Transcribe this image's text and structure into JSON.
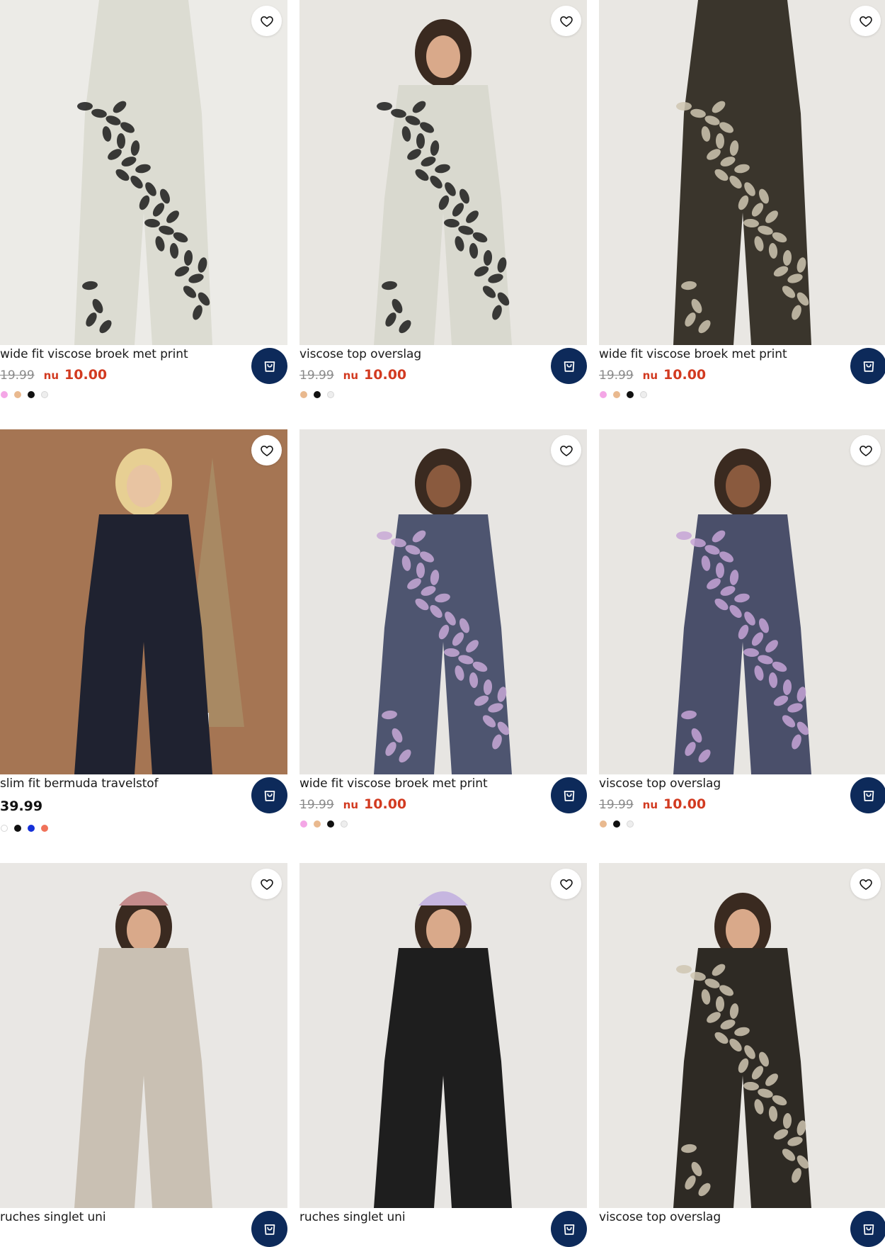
{
  "products": [
    {
      "title": "wide fit viscose broek met print",
      "old_price": "19.99",
      "nu_label": "nu",
      "price": "10.00",
      "sale": true,
      "swatches": [
        "#f4a6e6",
        "#e9b98f",
        "#111111",
        "#eeeeee"
      ],
      "bg": "#ecebe7",
      "garment": "#dcdcd2",
      "print": "#1b1b1b"
    },
    {
      "title": "viscose top overslag",
      "old_price": "19.99",
      "nu_label": "nu",
      "price": "10.00",
      "sale": true,
      "swatches": [
        "#e9b98f",
        "#111111",
        "#eeeeee"
      ],
      "bg": "#e8e6e1",
      "garment": "#d9d9cf",
      "print": "#1b1b1b"
    },
    {
      "title": "wide fit viscose broek met print",
      "old_price": "19.99",
      "nu_label": "nu",
      "price": "10.00",
      "sale": true,
      "swatches": [
        "#f4a6e6",
        "#e9b98f",
        "#111111",
        "#eeeeee"
      ],
      "bg": "#e9e7e3",
      "garment": "#3a352c",
      "print": "#cfc6b2"
    },
    {
      "title": "slim fit bermuda travelstof",
      "old_price": "",
      "nu_label": "",
      "price": "39.99",
      "sale": false,
      "swatches": [
        "#ffffff",
        "#111111",
        "#1530d8",
        "#f0725a"
      ],
      "bg": "#a57553",
      "garment": "#1f2230",
      "print": "#1f2230"
    },
    {
      "title": "wide fit viscose broek met print",
      "old_price": "19.99",
      "nu_label": "nu",
      "price": "10.00",
      "sale": true,
      "swatches": [
        "#f4a6e6",
        "#e9b98f",
        "#111111",
        "#eeeeee"
      ],
      "bg": "#e7e5e2",
      "garment": "#4e5570",
      "print": "#c8a9d6"
    },
    {
      "title": "viscose top overslag",
      "old_price": "19.99",
      "nu_label": "nu",
      "price": "10.00",
      "sale": true,
      "swatches": [
        "#e9b98f",
        "#111111",
        "#eeeeee"
      ],
      "bg": "#e8e6e2",
      "garment": "#4a4f6a",
      "print": "#c6a3d6"
    },
    {
      "title": "ruches singlet uni",
      "old_price": "",
      "nu_label": "",
      "price": "",
      "sale": false,
      "swatches": [],
      "bg": "#e9e7e4",
      "garment": "#c9c0b3",
      "print": "#c9c0b3"
    },
    {
      "title": "ruches singlet uni",
      "old_price": "",
      "nu_label": "",
      "price": "",
      "sale": false,
      "swatches": [],
      "bg": "#e8e6e3",
      "garment": "#1e1e1e",
      "print": "#1e1e1e"
    },
    {
      "title": "viscose top overslag",
      "old_price": "",
      "nu_label": "",
      "price": "",
      "sale": false,
      "swatches": [],
      "bg": "#e9e7e3",
      "garment": "#2e2a24",
      "print": "#cfc6b2"
    }
  ],
  "icons": {
    "favorite": "heart-icon",
    "cart": "shopping-bag-icon"
  },
  "colors": {
    "cart_button": "#0d2a5a",
    "sale_price": "#d23a20",
    "old_price": "#8a8a8a"
  }
}
